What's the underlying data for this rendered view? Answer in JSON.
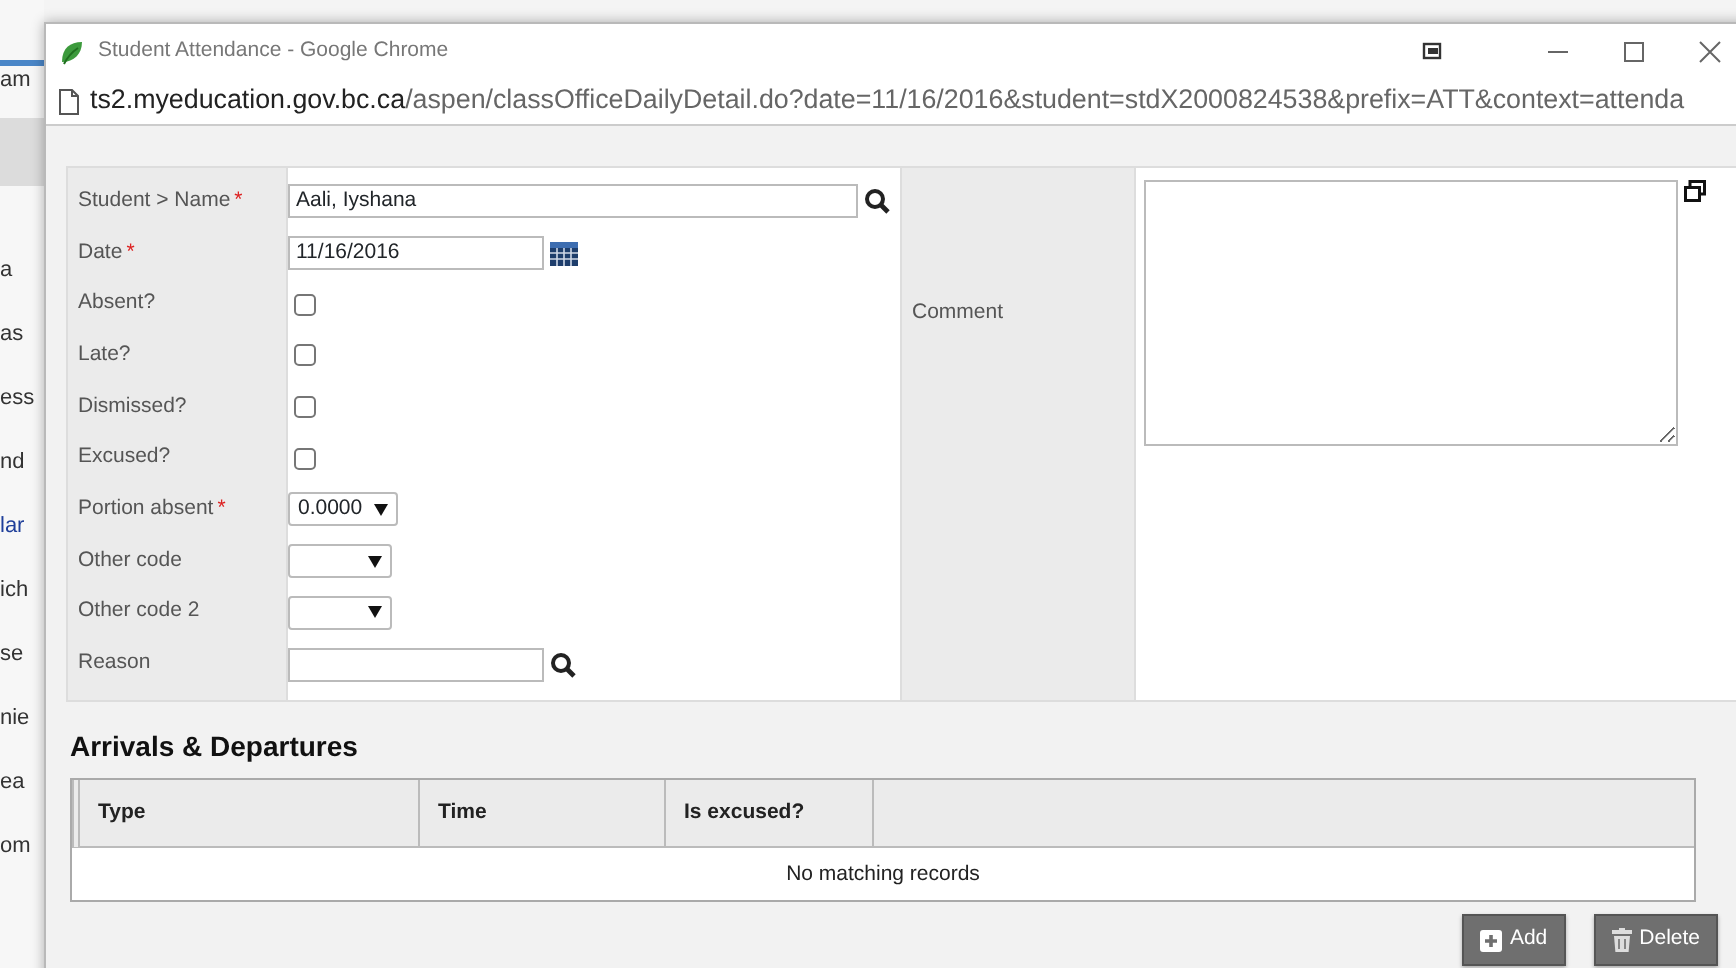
{
  "window": {
    "title": "Student Attendance - Google Chrome",
    "url_host": "ts2.myeducation.gov.bc.ca",
    "url_path": "/aspen/classOfficeDailyDetail.do?date=11/16/2016&student=stdX2000824538&prefix=ATT&context=attenda"
  },
  "background_fragments": [
    {
      "text": "am",
      "link": false
    },
    {
      "text": "a",
      "link": false
    },
    {
      "text": "as",
      "link": false
    },
    {
      "text": "ess",
      "link": false
    },
    {
      "text": "nd",
      "link": false
    },
    {
      "text": "lar",
      "link": true
    },
    {
      "text": "ich",
      "link": false
    },
    {
      "text": "se",
      "link": false
    },
    {
      "text": "nie",
      "link": false
    },
    {
      "text": "ea",
      "link": false
    },
    {
      "text": "om",
      "link": false
    }
  ],
  "form": {
    "fields": [
      {
        "label": "Student > Name",
        "required_mark": "*",
        "kind": "lookup",
        "value": "Aali, Iyshana"
      },
      {
        "label": "Date",
        "required_mark": "*",
        "kind": "date",
        "value": "11/16/2016"
      },
      {
        "label": "Absent?",
        "kind": "checkbox",
        "checked": false
      },
      {
        "label": "Late?",
        "kind": "checkbox",
        "checked": false
      },
      {
        "label": "Dismissed?",
        "kind": "checkbox",
        "checked": false
      },
      {
        "label": "Excused?",
        "kind": "checkbox",
        "checked": false
      },
      {
        "label": "Portion absent",
        "required_mark": "*",
        "kind": "select",
        "value": "0.0000"
      },
      {
        "label": "Other code",
        "kind": "select"
      },
      {
        "label": "Other code 2",
        "kind": "select"
      },
      {
        "label": "Reason",
        "kind": "lookup"
      }
    ],
    "comment": {
      "label": "Comment"
    }
  },
  "arrivals": {
    "title": "Arrivals & Departures",
    "columns": [
      "Type",
      "Time",
      "Is excused?"
    ],
    "empty_message": "No matching records",
    "buttons": [
      {
        "label": "Add",
        "kind": "add"
      },
      {
        "label": "Delete",
        "kind": "delete"
      }
    ]
  }
}
